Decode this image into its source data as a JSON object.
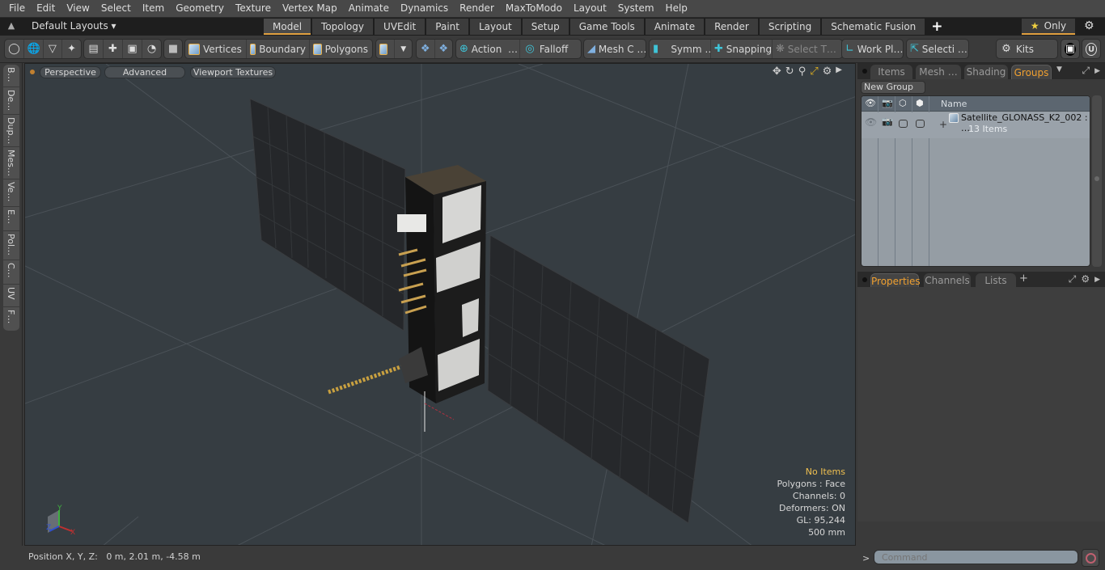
{
  "menu": [
    "File",
    "Edit",
    "View",
    "Select",
    "Item",
    "Geometry",
    "Texture",
    "Vertex Map",
    "Animate",
    "Dynamics",
    "Render",
    "MaxToModo",
    "Layout",
    "System",
    "Help"
  ],
  "layout_bar": {
    "layouts_label": "Default Layouts ▾",
    "tabs": [
      "Model",
      "Topology",
      "UVEdit",
      "Paint",
      "Layout",
      "Setup",
      "Game Tools",
      "Animate",
      "Render",
      "Scripting",
      "Schematic Fusion"
    ],
    "active_tab": "Model",
    "add_tab": "+",
    "only_label": "Only",
    "only_star": "★"
  },
  "toolbar": {
    "select_modes": [
      "Vertices",
      "Boundary",
      "Polygons"
    ],
    "action": "Action",
    "falloff": "Falloff",
    "mesh_c": "Mesh C …",
    "symm": "Symm …",
    "snapping": "Snapping",
    "select_t": "Select T…",
    "work_pl": "Work Pl…",
    "selecti": "Selecti …",
    "kits": "Kits",
    "ellipsis": "…"
  },
  "left_tabs": [
    "B…",
    "De…",
    "Dup…",
    "Mes…",
    "Ve…",
    "E…",
    "Pol…",
    "C…",
    "UV",
    "F…"
  ],
  "viewport": {
    "buttons": [
      "Perspective",
      "Advanced",
      "Viewport Textures"
    ],
    "stats": {
      "selection": "No Items",
      "polygons": "Polygons : Face",
      "channels": "Channels: 0",
      "deformers": "Deformers: ON",
      "gl": "GL: 95,244",
      "scale": "500 mm"
    },
    "axis_labels": {
      "x": "X",
      "y": "Y",
      "z": "Z"
    }
  },
  "groups_panel": {
    "tabs": [
      "Items",
      "Mesh …",
      "Shading",
      "Groups"
    ],
    "active_tab": "Groups",
    "new_group": "New Group",
    "name_header": "Name",
    "rows": [
      {
        "name": "Satellite_GLONASS_K2_002 : …",
        "count": "13 Items",
        "expand": "+"
      }
    ]
  },
  "properties_panel": {
    "tabs": [
      "Properties",
      "Channels",
      "Lists"
    ],
    "active_tab": "Properties",
    "add_tab": "+"
  },
  "status": {
    "position_label": "Position X, Y, Z:",
    "position_value": "0 m, 2.01 m, -4.58 m"
  },
  "command": {
    "prompt": ">",
    "placeholder": "Command"
  },
  "colors": {
    "accent": "#e0a040",
    "stats_highlight": "#f0c050",
    "viewport_bg": "#363d42"
  }
}
